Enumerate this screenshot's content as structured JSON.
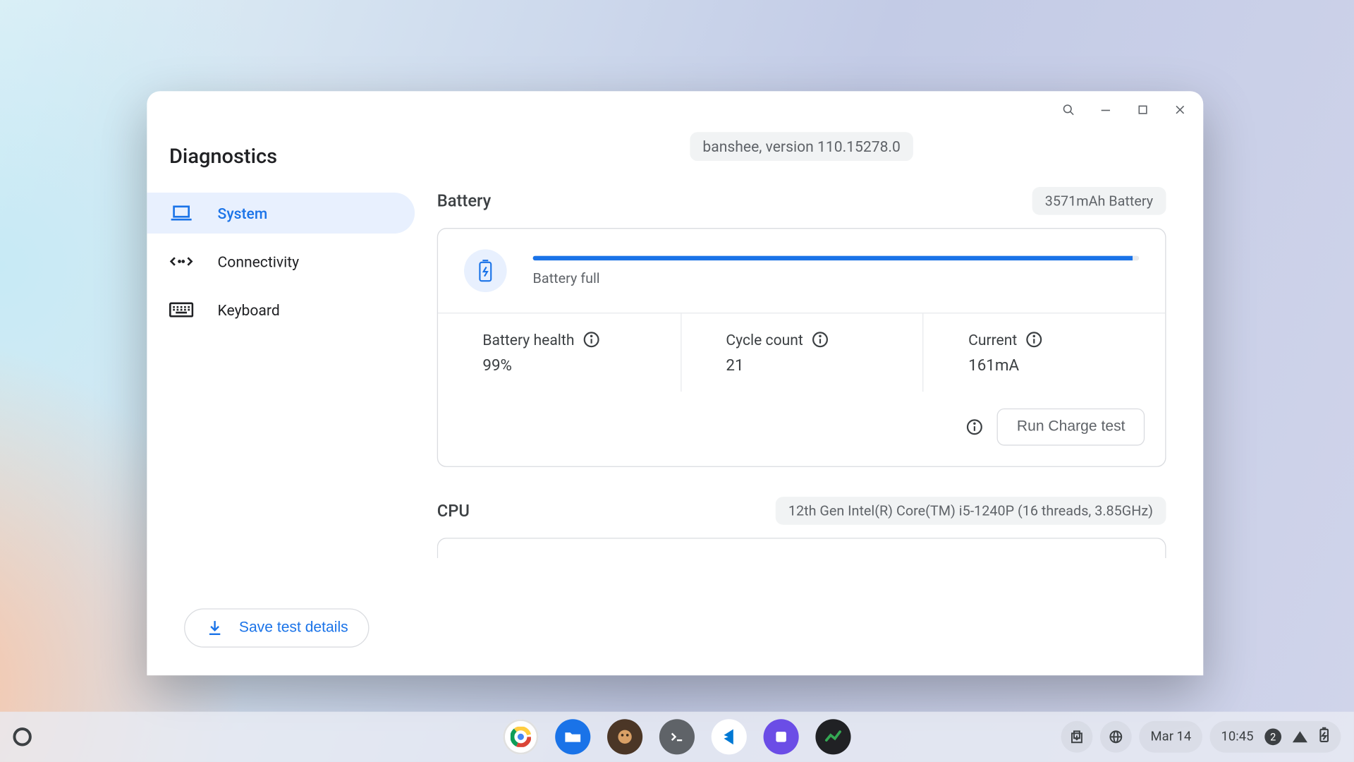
{
  "window": {
    "title": "Diagnostics"
  },
  "sidebar": {
    "items": [
      {
        "label": "System"
      },
      {
        "label": "Connectivity"
      },
      {
        "label": "Keyboard"
      }
    ],
    "save_label": "Save test details"
  },
  "system": {
    "version_chip": "banshee, version 110.15278.0",
    "battery": {
      "title": "Battery",
      "capacity_chip": "3571mAh Battery",
      "progress_pct": 99,
      "status_label": "Battery full",
      "stats": [
        {
          "label": "Battery health",
          "value": "99%"
        },
        {
          "label": "Cycle count",
          "value": "21"
        },
        {
          "label": "Current",
          "value": "161mA"
        }
      ],
      "run_label": "Run Charge test"
    },
    "cpu": {
      "title": "CPU",
      "chip": "12th Gen Intel(R) Core(TM) i5-1240P (16 threads, 3.85GHz)"
    }
  },
  "shelf": {
    "date": "Mar 14",
    "time": "10:45",
    "notif_count": "2"
  }
}
